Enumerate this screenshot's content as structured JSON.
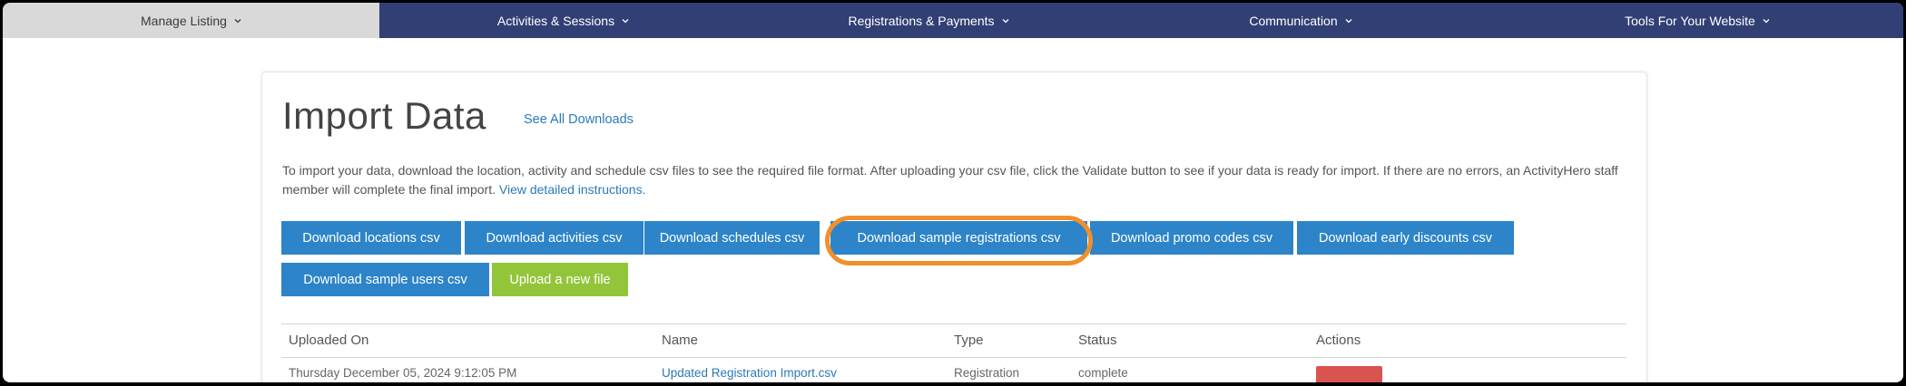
{
  "nav": {
    "items": [
      {
        "label": "Manage Listing",
        "active": true
      },
      {
        "label": "Activities & Sessions",
        "active": false
      },
      {
        "label": "Registrations & Payments",
        "active": false
      },
      {
        "label": "Communication",
        "active": false
      },
      {
        "label": "Tools For Your Website",
        "active": false
      }
    ]
  },
  "page": {
    "title": "Import Data",
    "see_all_link": "See All Downloads",
    "intro_text": "To import your data, download the location, activity and schedule csv files to see the required file format. After uploading your csv file, click the Validate button to see if your data is ready for import. If there are no errors, an ActivityHero staff member will complete the final import.",
    "instructions_link": "View detailed instructions."
  },
  "buttons": {
    "locations": "Download locations csv",
    "activities": "Download activities csv",
    "schedules": "Download schedules csv",
    "sample_registrations": "Download sample registrations csv",
    "promo_codes": "Download promo codes csv",
    "early_discounts": "Download early discounts csv",
    "sample_users": "Download sample users csv",
    "upload": "Upload a new file"
  },
  "table": {
    "headers": {
      "uploaded_on": "Uploaded On",
      "name": "Name",
      "type": "Type",
      "status": "Status",
      "actions": "Actions"
    },
    "rows": [
      {
        "uploaded_on": "Thursday December 05, 2024 9:12:05 PM",
        "name": "Updated Registration Import.csv",
        "type": "Registration",
        "status": "complete"
      }
    ]
  },
  "colors": {
    "nav_bg": "#313f74",
    "nav_active_bg": "#d9d9d9",
    "primary_button": "#2d84c8",
    "upload_button": "#93c53b",
    "highlight_ring": "#f0902b",
    "delete_button": "#d9534f",
    "link": "#2a7ab8"
  }
}
